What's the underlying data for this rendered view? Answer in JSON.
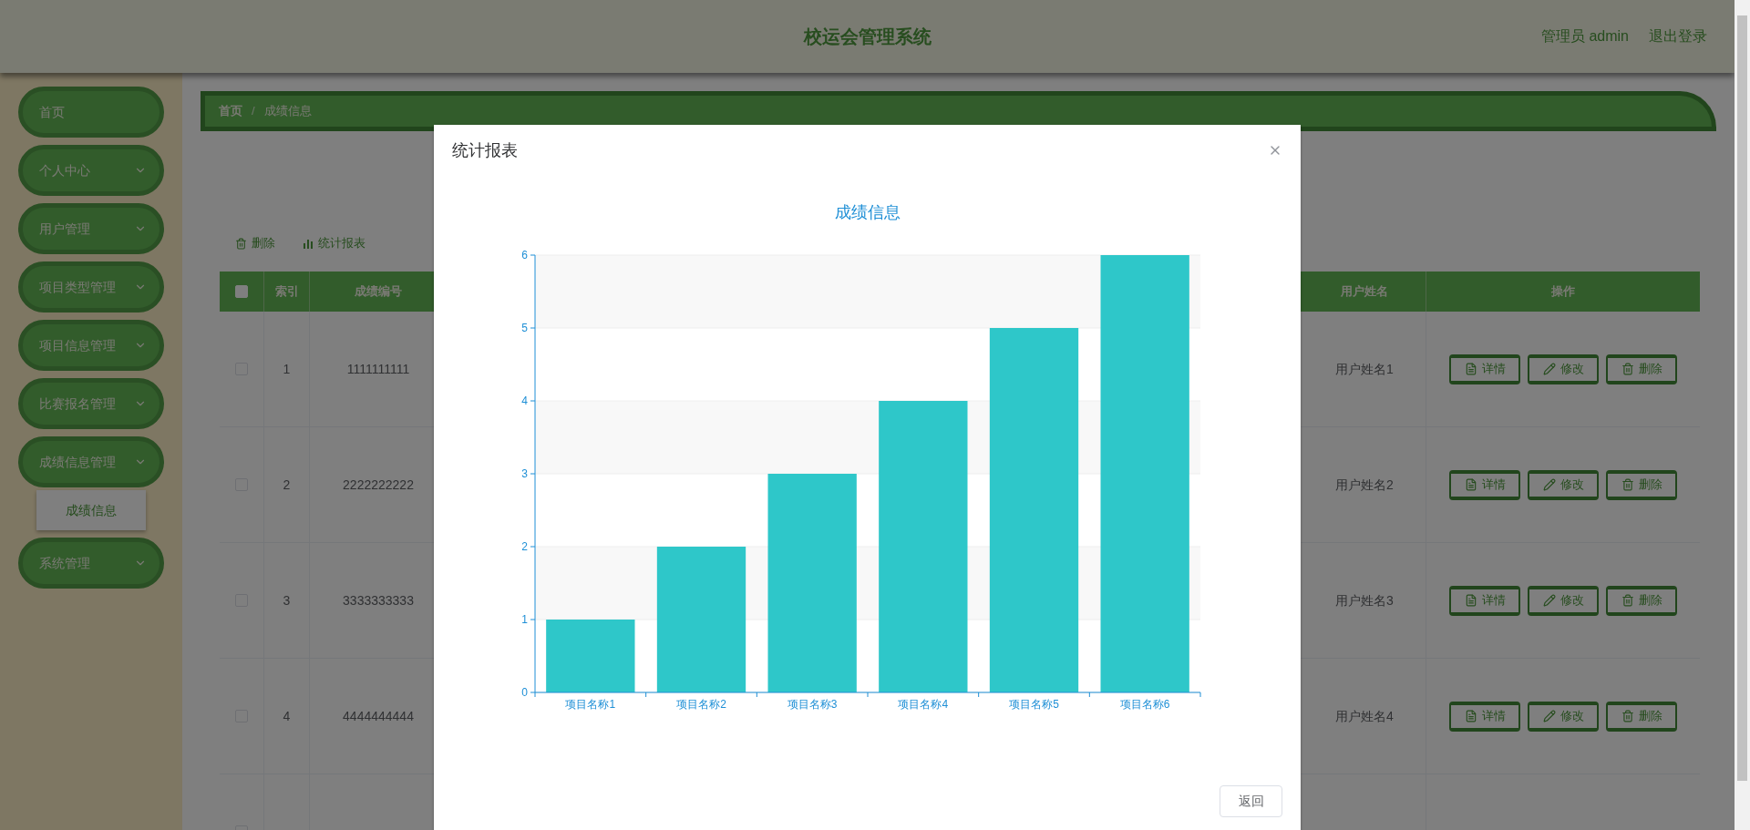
{
  "header": {
    "title": "校运会管理系统",
    "user_label": "管理员 admin",
    "logout": "退出登录"
  },
  "sidebar": {
    "items": [
      {
        "label": "首页",
        "has_submenu": false
      },
      {
        "label": "个人中心",
        "has_submenu": true
      },
      {
        "label": "用户管理",
        "has_submenu": true
      },
      {
        "label": "项目类型管理",
        "has_submenu": true
      },
      {
        "label": "项目信息管理",
        "has_submenu": true
      },
      {
        "label": "比赛报名管理",
        "has_submenu": true
      },
      {
        "label": "成绩信息管理",
        "has_submenu": true,
        "children": [
          {
            "label": "成绩信息",
            "selected": true
          }
        ]
      },
      {
        "label": "系统管理",
        "has_submenu": true
      }
    ]
  },
  "breadcrumb": {
    "separator": "/",
    "items": [
      "首页",
      "成绩信息"
    ]
  },
  "toolbar": [
    {
      "kind": "delete",
      "label": "删除"
    },
    {
      "kind": "report",
      "label": "统计报表"
    }
  ],
  "table": {
    "select_all_checked": false,
    "columns": [
      "索引",
      "成绩编号",
      "用户姓名",
      "操作"
    ],
    "rows": [
      {
        "checked": false,
        "index": "1",
        "code": "1111111111",
        "user_name": "用户姓名1",
        "actions": [
          "详情",
          "修改",
          "删除"
        ]
      },
      {
        "checked": false,
        "index": "2",
        "code": "2222222222",
        "user_name": "用户姓名2",
        "actions": [
          "详情",
          "修改",
          "删除"
        ]
      },
      {
        "checked": false,
        "index": "3",
        "code": "3333333333",
        "user_name": "用户姓名3",
        "actions": [
          "详情",
          "修改",
          "删除"
        ]
      },
      {
        "checked": false,
        "index": "4",
        "code": "4444444444",
        "user_name": "用户姓名4",
        "actions": [
          "详情",
          "修改",
          "删除"
        ]
      },
      {
        "checked": false
      }
    ]
  },
  "modal": {
    "title": "统计报表",
    "button": "返回",
    "chart_data": {
      "type": "bar",
      "title": "成绩信息",
      "categories": [
        "项目名称1",
        "项目名称2",
        "项目名称3",
        "项目名称4",
        "项目名称5",
        "项目名称6"
      ],
      "series": [
        {
          "color": "#2ec7c9",
          "values": [
            1,
            2,
            3,
            4,
            5,
            6
          ]
        }
      ],
      "grid": true,
      "ylim": [
        0,
        6
      ],
      "yticks": [
        0,
        1,
        2,
        3,
        4,
        5,
        6
      ]
    }
  }
}
